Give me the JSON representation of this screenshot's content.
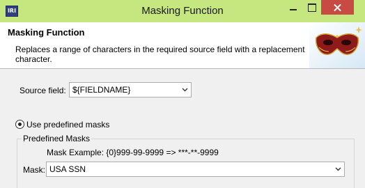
{
  "window": {
    "title": "Masking Function",
    "app_badge": "IRI"
  },
  "header": {
    "title": "Masking Function",
    "description": "Replaces a range of characters in the required source field with a replacement character.",
    "graphic": "carnival-mask-icon"
  },
  "source_field": {
    "label": "Source field:",
    "value": "${FIELDNAME}"
  },
  "predefined": {
    "radio_label": "Use predefined masks",
    "selected": true,
    "group_title": "Predefined Masks",
    "example": "Mask Example: {0}999-99-9999 => ***-**-9999",
    "mask_label": "Mask:",
    "mask_value": "USA SSN"
  },
  "colors": {
    "titlebar": "#c6e67f",
    "close": "#c74b44",
    "dialog_bg": "#f0f0f0"
  }
}
